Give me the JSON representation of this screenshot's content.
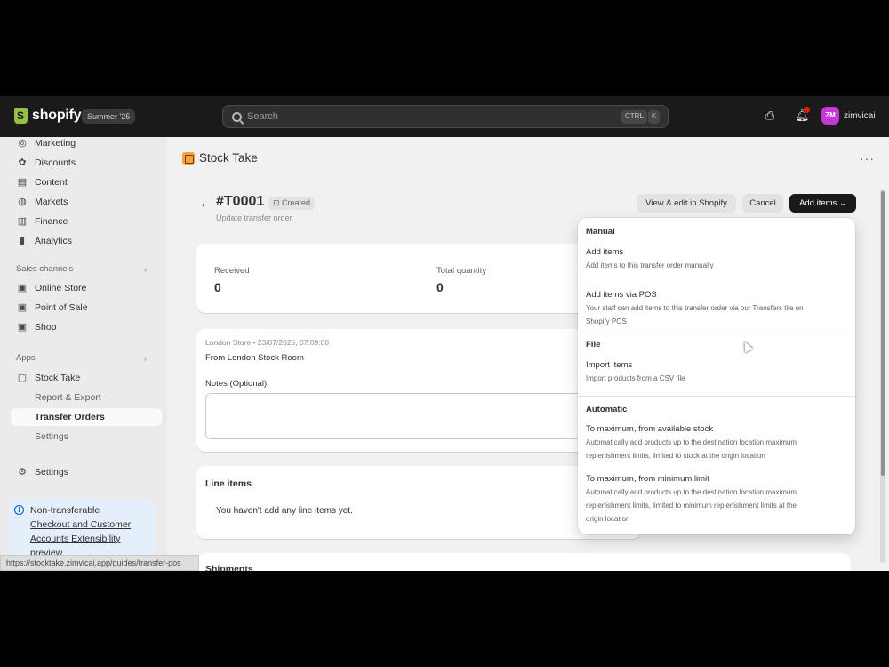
{
  "topbar": {
    "logo_text": "shopify",
    "edition": "Summer '25",
    "search_placeholder": "Search",
    "kbd_ctrl": "CTRL",
    "kbd_k": "K",
    "avatar_initials": "ZM",
    "store_name": "zimvicai"
  },
  "sidebar": {
    "items_top": [
      {
        "label": "Marketing",
        "icon": "target-icon"
      },
      {
        "label": "Discounts",
        "icon": "discount-icon"
      },
      {
        "label": "Content",
        "icon": "content-icon"
      },
      {
        "label": "Markets",
        "icon": "globe-icon"
      },
      {
        "label": "Finance",
        "icon": "bank-icon"
      },
      {
        "label": "Analytics",
        "icon": "chart-icon"
      }
    ],
    "sales_channels_label": "Sales channels",
    "sales_channels": [
      {
        "label": "Online Store",
        "icon": "store-icon"
      },
      {
        "label": "Point of Sale",
        "icon": "pos-icon"
      },
      {
        "label": "Shop",
        "icon": "shop-icon"
      }
    ],
    "apps_label": "Apps",
    "apps": [
      {
        "label": "Stock Take",
        "icon": "app-icon"
      },
      {
        "label": "Report & Export"
      },
      {
        "label": "Transfer Orders",
        "active": true
      },
      {
        "label": "Settings"
      }
    ],
    "settings_label": "Settings",
    "notice": {
      "line1": "Non-transferable",
      "line2": "Checkout and Customer",
      "line3": "Accounts Extensibility",
      "line4": "preview"
    },
    "status_url": "https://stocktake.zimvicai.app/guides/transfer-pos"
  },
  "main": {
    "app_title": "Stock Take",
    "order_id": "#T0001",
    "badge": "Created",
    "subtitle": "Update transfer order",
    "buttons": {
      "view_edit": "View & edit in Shopify",
      "cancel": "Cancel",
      "add_items": "Add items"
    },
    "summary": {
      "received_label": "Received",
      "received_value": "0",
      "total_label": "Total quantity",
      "total_value": "0"
    },
    "transfer": {
      "meta": "London Store • 23/07/2025, 07:09:00",
      "from": "From London Stock Room",
      "notes_label": "Notes (Optional)"
    },
    "line_items": {
      "title": "Line items",
      "empty": "You haven't add any line items yet."
    },
    "bottom_card_title": "Shipments"
  },
  "dropdown": {
    "manual_label": "Manual",
    "add_items_title": "Add items",
    "add_items_desc": "Add items to this transfer order manually",
    "add_pos_title": "Add items via POS",
    "add_pos_desc1": "Your staff can add items to this transfer order via our Transfers tile on",
    "add_pos_desc2": "Shopify POS",
    "file_label": "File",
    "import_title": "Import items",
    "import_desc": "Import products from a CSV file",
    "automatic_label": "Automatic",
    "max_avail_title": "To maximum, from available stock",
    "max_avail_desc1": "Automatically add products up to the destination location maximum",
    "max_avail_desc2": "replenishment limits, limited to stock at the origin location",
    "max_min_title": "To maximum, from minimum limit",
    "max_min_desc1": "Automatically add products up to the destination location maximum",
    "max_min_desc2": "replenishment limits, limited to minimum replenishment limits at the",
    "max_min_desc3": "origin location"
  }
}
